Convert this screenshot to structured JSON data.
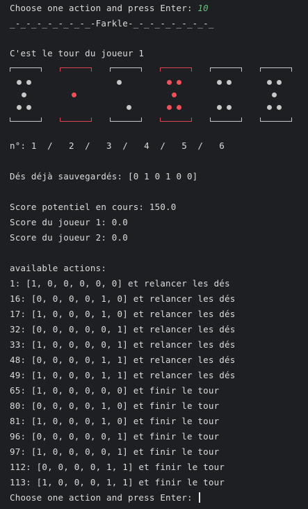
{
  "header": {
    "prompt_text": "Choose one action and press Enter: ",
    "prompt_value": "10",
    "banner": "_-_-_-_-_-_-_-_-Farkle-_-_-_-_-_-_-_-_"
  },
  "turn_line": "C'est le tour du joueur 1",
  "dice": [
    {
      "value": 5,
      "saved": false
    },
    {
      "value": 1,
      "saved": true
    },
    {
      "value": 2,
      "saved": false
    },
    {
      "value": 5,
      "saved": true
    },
    {
      "value": 4,
      "saved": false
    },
    {
      "value": 5,
      "saved": false
    }
  ],
  "dice_index_line": "n°: 1  /   2  /   3  /   4  /   5  /   6",
  "saved_line": "Dés déjà sauvegardés: [0 1 0 1 0 0]",
  "scores": {
    "potential": "Score potentiel en cours: 150.0",
    "player1": "Score du joueur 1: 0.0",
    "player2": "Score du joueur 2: 0.0"
  },
  "actions_header": "available actions:",
  "actions": [
    "1: [1, 0, 0, 0, 0, 0] et relancer les dés",
    "16: [0, 0, 0, 0, 1, 0] et relancer les dés",
    "17: [1, 0, 0, 0, 1, 0] et relancer les dés",
    "32: [0, 0, 0, 0, 0, 1] et relancer les dés",
    "33: [1, 0, 0, 0, 0, 1] et relancer les dés",
    "48: [0, 0, 0, 0, 1, 1] et relancer les dés",
    "49: [1, 0, 0, 0, 1, 1] et relancer les dés",
    "65: [1, 0, 0, 0, 0, 0] et finir le tour",
    "80: [0, 0, 0, 0, 1, 0] et finir le tour",
    "81: [1, 0, 0, 0, 1, 0] et finir le tour",
    "96: [0, 0, 0, 0, 0, 1] et finir le tour",
    "97: [1, 0, 0, 0, 0, 1] et finir le tour",
    "112: [0, 0, 0, 0, 1, 1] et finir le tour",
    "113: [1, 0, 0, 0, 1, 1] et finir le tour"
  ],
  "final_prompt": "Choose one action and press Enter: "
}
